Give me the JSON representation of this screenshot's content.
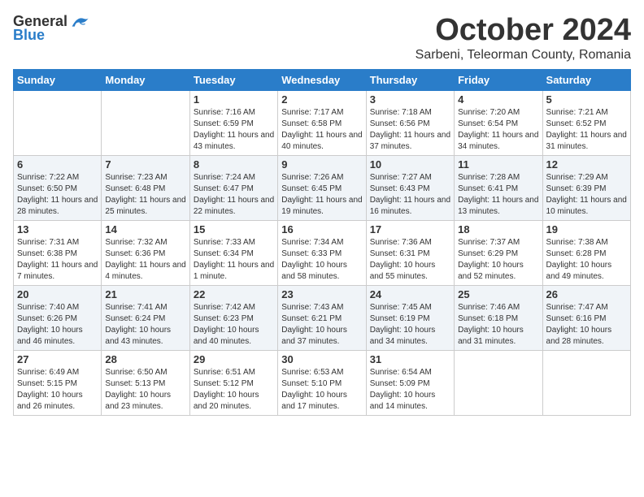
{
  "header": {
    "logo_general": "General",
    "logo_blue": "Blue",
    "month_title": "October 2024",
    "location": "Sarbeni, Teleorman County, Romania"
  },
  "days_of_week": [
    "Sunday",
    "Monday",
    "Tuesday",
    "Wednesday",
    "Thursday",
    "Friday",
    "Saturday"
  ],
  "weeks": [
    [
      {
        "day": "",
        "info": ""
      },
      {
        "day": "",
        "info": ""
      },
      {
        "day": "1",
        "info": "Sunrise: 7:16 AM\nSunset: 6:59 PM\nDaylight: 11 hours and 43 minutes."
      },
      {
        "day": "2",
        "info": "Sunrise: 7:17 AM\nSunset: 6:58 PM\nDaylight: 11 hours and 40 minutes."
      },
      {
        "day": "3",
        "info": "Sunrise: 7:18 AM\nSunset: 6:56 PM\nDaylight: 11 hours and 37 minutes."
      },
      {
        "day": "4",
        "info": "Sunrise: 7:20 AM\nSunset: 6:54 PM\nDaylight: 11 hours and 34 minutes."
      },
      {
        "day": "5",
        "info": "Sunrise: 7:21 AM\nSunset: 6:52 PM\nDaylight: 11 hours and 31 minutes."
      }
    ],
    [
      {
        "day": "6",
        "info": "Sunrise: 7:22 AM\nSunset: 6:50 PM\nDaylight: 11 hours and 28 minutes."
      },
      {
        "day": "7",
        "info": "Sunrise: 7:23 AM\nSunset: 6:48 PM\nDaylight: 11 hours and 25 minutes."
      },
      {
        "day": "8",
        "info": "Sunrise: 7:24 AM\nSunset: 6:47 PM\nDaylight: 11 hours and 22 minutes."
      },
      {
        "day": "9",
        "info": "Sunrise: 7:26 AM\nSunset: 6:45 PM\nDaylight: 11 hours and 19 minutes."
      },
      {
        "day": "10",
        "info": "Sunrise: 7:27 AM\nSunset: 6:43 PM\nDaylight: 11 hours and 16 minutes."
      },
      {
        "day": "11",
        "info": "Sunrise: 7:28 AM\nSunset: 6:41 PM\nDaylight: 11 hours and 13 minutes."
      },
      {
        "day": "12",
        "info": "Sunrise: 7:29 AM\nSunset: 6:39 PM\nDaylight: 11 hours and 10 minutes."
      }
    ],
    [
      {
        "day": "13",
        "info": "Sunrise: 7:31 AM\nSunset: 6:38 PM\nDaylight: 11 hours and 7 minutes."
      },
      {
        "day": "14",
        "info": "Sunrise: 7:32 AM\nSunset: 6:36 PM\nDaylight: 11 hours and 4 minutes."
      },
      {
        "day": "15",
        "info": "Sunrise: 7:33 AM\nSunset: 6:34 PM\nDaylight: 11 hours and 1 minute."
      },
      {
        "day": "16",
        "info": "Sunrise: 7:34 AM\nSunset: 6:33 PM\nDaylight: 10 hours and 58 minutes."
      },
      {
        "day": "17",
        "info": "Sunrise: 7:36 AM\nSunset: 6:31 PM\nDaylight: 10 hours and 55 minutes."
      },
      {
        "day": "18",
        "info": "Sunrise: 7:37 AM\nSunset: 6:29 PM\nDaylight: 10 hours and 52 minutes."
      },
      {
        "day": "19",
        "info": "Sunrise: 7:38 AM\nSunset: 6:28 PM\nDaylight: 10 hours and 49 minutes."
      }
    ],
    [
      {
        "day": "20",
        "info": "Sunrise: 7:40 AM\nSunset: 6:26 PM\nDaylight: 10 hours and 46 minutes."
      },
      {
        "day": "21",
        "info": "Sunrise: 7:41 AM\nSunset: 6:24 PM\nDaylight: 10 hours and 43 minutes."
      },
      {
        "day": "22",
        "info": "Sunrise: 7:42 AM\nSunset: 6:23 PM\nDaylight: 10 hours and 40 minutes."
      },
      {
        "day": "23",
        "info": "Sunrise: 7:43 AM\nSunset: 6:21 PM\nDaylight: 10 hours and 37 minutes."
      },
      {
        "day": "24",
        "info": "Sunrise: 7:45 AM\nSunset: 6:19 PM\nDaylight: 10 hours and 34 minutes."
      },
      {
        "day": "25",
        "info": "Sunrise: 7:46 AM\nSunset: 6:18 PM\nDaylight: 10 hours and 31 minutes."
      },
      {
        "day": "26",
        "info": "Sunrise: 7:47 AM\nSunset: 6:16 PM\nDaylight: 10 hours and 28 minutes."
      }
    ],
    [
      {
        "day": "27",
        "info": "Sunrise: 6:49 AM\nSunset: 5:15 PM\nDaylight: 10 hours and 26 minutes."
      },
      {
        "day": "28",
        "info": "Sunrise: 6:50 AM\nSunset: 5:13 PM\nDaylight: 10 hours and 23 minutes."
      },
      {
        "day": "29",
        "info": "Sunrise: 6:51 AM\nSunset: 5:12 PM\nDaylight: 10 hours and 20 minutes."
      },
      {
        "day": "30",
        "info": "Sunrise: 6:53 AM\nSunset: 5:10 PM\nDaylight: 10 hours and 17 minutes."
      },
      {
        "day": "31",
        "info": "Sunrise: 6:54 AM\nSunset: 5:09 PM\nDaylight: 10 hours and 14 minutes."
      },
      {
        "day": "",
        "info": ""
      },
      {
        "day": "",
        "info": ""
      }
    ]
  ]
}
